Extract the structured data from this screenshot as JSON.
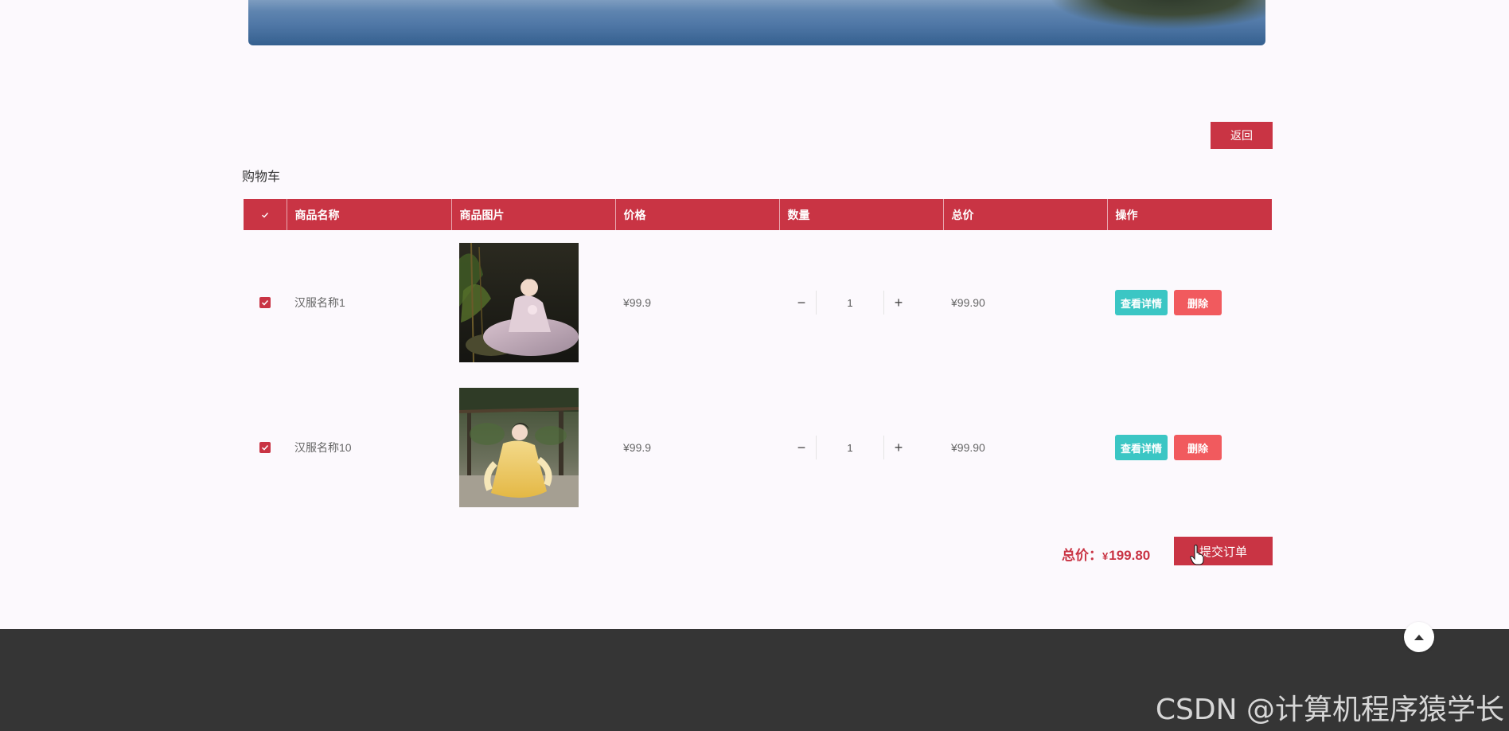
{
  "header": {
    "back_button": "返回"
  },
  "cart": {
    "title": "购物车",
    "columns": {
      "name": "商品名称",
      "image": "商品图片",
      "price": "价格",
      "quantity": "数量",
      "total": "总价",
      "actions": "操作"
    },
    "items": [
      {
        "checked": true,
        "name": "汉服名称1",
        "image": "hanfu-photo-1",
        "price": "¥99.9",
        "quantity": "1",
        "total": "¥99.90",
        "detail_button": "查看详情",
        "delete_button": "删除"
      },
      {
        "checked": true,
        "name": "汉服名称10",
        "image": "hanfu-photo-10",
        "price": "¥99.9",
        "quantity": "1",
        "total": "¥99.90",
        "detail_button": "查看详情",
        "delete_button": "删除"
      }
    ],
    "summary": {
      "label": "总价：",
      "currency": "¥",
      "amount": "199.80",
      "submit_button": "提交订单"
    }
  },
  "footer": {
    "watermark": "CSDN @计算机程序猿学长"
  },
  "colors": {
    "primary": "#c93444",
    "detail": "#3bc6c4",
    "delete": "#f15a5e",
    "footer_bg": "#353535",
    "page_bg": "#fcf9fd"
  },
  "icons": {
    "check": "check-icon",
    "minus": "minus-icon",
    "plus": "plus-icon",
    "back_to_top": "arrow-up-icon",
    "cursor": "hand-pointer-icon"
  }
}
